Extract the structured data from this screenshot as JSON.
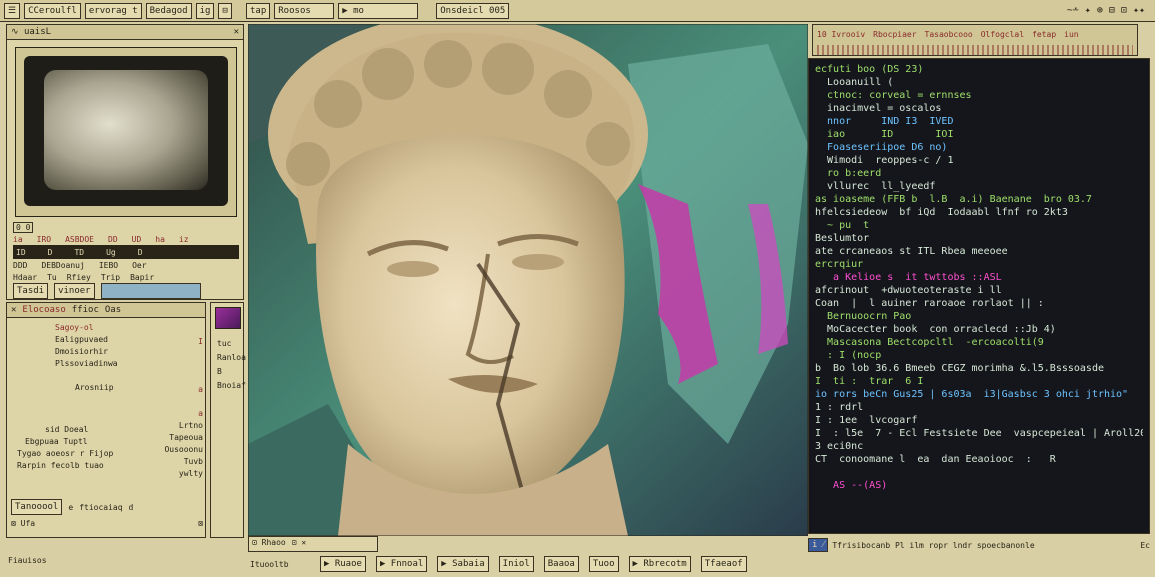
{
  "top_bar": {
    "left_buttons": [
      "CCeroulfl",
      "ervorag t",
      "Bedagod",
      "ig",
      "⊟"
    ],
    "tabs": [
      "tap",
      "Roosos",
      "mo",
      "Onsdeicl 005"
    ],
    "right_text": "~∸ ✦ ⊕ ⊟ ⊡ ✦✦"
  },
  "left_panel": {
    "title": "∿ uaisL",
    "corner_icon": "✕",
    "info_rows": [
      [
        "0 0",
        "",
        "",
        ""
      ],
      [
        "ia",
        "IRO",
        "ASBDOE",
        "DD",
        "UD",
        "ha",
        "iz"
      ],
      [
        "ID",
        "D",
        "TD",
        "Ug",
        "D"
      ],
      [
        "DDD",
        "DEBDoanuj",
        "IEBO",
        "Oer"
      ],
      [
        "Hdaar",
        "Tu",
        "Rfiey",
        "Trip",
        "Bapir"
      ],
      [
        "Tasdi",
        "vinoer"
      ]
    ],
    "toolbar": [
      "✕",
      "Elocoaso",
      "ffioc",
      "Oas",
      ""
    ],
    "list_title": "Sagoy-ol",
    "list_items": [
      "Ealigpuvaed",
      "Dmoisiorhir",
      "Plssoviadinwa",
      "",
      "Arosniip",
      "",
      "sid   Doeal",
      "Ebgpuaa Tuptl",
      "Tygao aoeosr r Fijop",
      "Rarpin fecolb tuao"
    ],
    "right_column": [
      "I",
      "",
      "",
      "",
      "a",
      "a",
      "Lrtno",
      "Tapeoua",
      "Ousooonu",
      "Tuvb",
      "ywlty"
    ],
    "bottom_row": [
      "Tanooool",
      "e",
      "ftiocaiaq",
      "d"
    ],
    "footer_row": [
      "⊠ Ufa",
      "⊠"
    ],
    "status": "Fiauisos"
  },
  "mid_tools": {
    "items": [
      "tuc",
      "Ranloa",
      "B",
      "Bnoiaf"
    ]
  },
  "center_image": {
    "label": "Classical marble statue head with glitch painting"
  },
  "bottom_center": {
    "buttons": [
      "⊡ Rhaoo",
      "⊡ ✕",
      "Ituooltb"
    ],
    "items": [
      "Ruaoe",
      "Fnnoal",
      "Sabaia",
      "Iniol",
      "Baaoa",
      "Tuoo",
      "Rbrecotm",
      "Tfaeaof"
    ]
  },
  "right_panel": {
    "header": [
      "10 Ivrooiv",
      "Rbocpiaer",
      "Tasaobcooo",
      "Olfogclal",
      "fetap",
      "iun"
    ],
    "code_lines": [
      {
        "t": "ecfuti boo (DS 23)",
        "c": "#9ee06a"
      },
      {
        "t": "  Looanuill (",
        "c": "#d6e8d6"
      },
      {
        "t": "  ctnoc: corveal = ernnses",
        "c": "#9ee06a"
      },
      {
        "t": "  inacimvel = oscalos",
        "c": "#d6e8d6"
      },
      {
        "t": "  nnor     IND I3  IVED",
        "c": "#6cc3ff"
      },
      {
        "t": "  iao      ID       IOI",
        "c": "#9ee06a"
      },
      {
        "t": "  Foaseseriipoe D6 no)",
        "c": "#6cc3ff"
      },
      {
        "t": "  Wimodi  reoppes-c / 1",
        "c": "#d6e8d6"
      },
      {
        "t": "  ro b:eerd",
        "c": "#9ee06a"
      },
      {
        "t": "  vllurec  ll_lyeedf",
        "c": "#d6e8d6"
      },
      {
        "t": "as ioaseme (FFB b  l.B  a.i) Baenane  bro 03.7",
        "c": "#9ee06a"
      },
      {
        "t": "hfelcsiedeow  bf iQd  Iodaabl lfnf ro 2kt3",
        "c": "#d6e8d6"
      },
      {
        "t": "  ~ pu  t",
        "c": "#9ee06a"
      },
      {
        "t": "Beslumtor",
        "c": "#d6e8d6"
      },
      {
        "t": "ate crcaneaos st ITL Rbea meeoee",
        "c": "#d6e8d6"
      },
      {
        "t": "ercrqiur",
        "c": "#9ee06a"
      },
      {
        "t": "   a Kelioe s  it twttobs ::ASL",
        "c": "#ff4fd0"
      },
      {
        "t": "afcrinout  +dwuoteoteraste i ll",
        "c": "#d6e8d6"
      },
      {
        "t": "Coan  |  l auiner raroaoe rorlaot || :",
        "c": "#d6e8d6"
      },
      {
        "t": "  Bernuoocrn Pao",
        "c": "#9ee06a"
      },
      {
        "t": "  MoCacecter book  con orraclecd ::Jb 4)",
        "c": "#d6e8d6"
      },
      {
        "t": "  Mascasona Bectcopcltl  -ercoacolti(9",
        "c": "#9ee06a"
      },
      {
        "t": "  : I (nocp",
        "c": "#9ee06a"
      },
      {
        "t": "b  Bo lob 36.6 Bmeeb CEGZ morimha &.l5.Bsssoasde",
        "c": "#d6e8d6"
      },
      {
        "t": "I  ti :  trar  6 I",
        "c": "#9ee06a"
      },
      {
        "t": "io rors beCn Gus25 | 6s03a  i3|Gasbsc 3 ohci jtrhio\"",
        "c": "#6cc3ff"
      },
      {
        "t": "1 : rdrl",
        "c": "#d6e8d6"
      },
      {
        "t": "I : 1ee  lvcogarf",
        "c": "#d6e8d6"
      },
      {
        "t": "I  : l5e  7 - Ecl Festsiete Dee  vaspcepeieal | Aroll20.1521",
        "c": "#d6e8d6"
      },
      {
        "t": "3 eci0nc",
        "c": "#d6e8d6"
      },
      {
        "t": "CT  conoomane l  ea  dan Eeaoiooc  :   R",
        "c": "#d6e8d6"
      },
      {
        "t": "",
        "c": "#9ee06a"
      },
      {
        "t": "   AS --(AS)",
        "c": "#ff4fd0"
      },
      {
        "t": "",
        "c": "#9ee06a"
      },
      {
        "t": "",
        "c": "#9ee06a"
      },
      {
        "t": "",
        "c": "#9ee06a"
      }
    ],
    "footer": "Tfrisibocanb Pl ilm ropr lndr spoecbanonle",
    "footer_right": "Ec"
  },
  "colors": {
    "paper": "#d8cfa4",
    "terminal_bg": "#15161c",
    "green": "#9ee06a",
    "magenta": "#ff4fd0",
    "cyan": "#6cc3ff"
  }
}
